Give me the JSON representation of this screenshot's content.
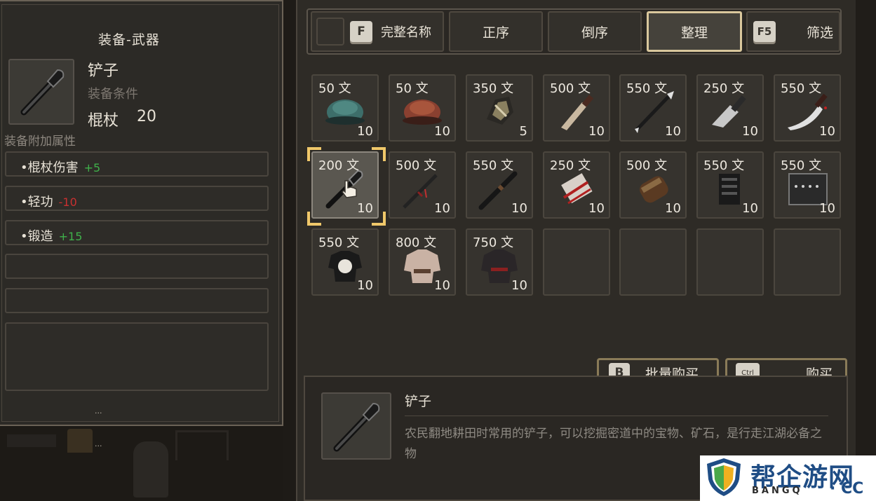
{
  "left": {
    "title": "装备-武器",
    "item_name": "铲子",
    "req_label": "装备条件",
    "req_stat": "棍杖",
    "req_value": "20",
    "extra_label": "装备附加属性",
    "attributes": [
      {
        "name": "•棍杖伤害",
        "value": "+5",
        "kind": "green"
      },
      {
        "name": "•轻功",
        "value": "-10",
        "kind": "red"
      },
      {
        "name": "•锻造",
        "value": "+15",
        "kind": "green"
      }
    ],
    "dots": "..."
  },
  "sortbar": {
    "key_f": "F",
    "full_name": "完整名称",
    "asc": "正序",
    "desc": "倒序",
    "arrange": "整理",
    "key_f5": "F5",
    "filter": "筛选"
  },
  "grid": {
    "currency": "文",
    "items": [
      {
        "price": "50",
        "qty": "10",
        "icon": "teal-cap-icon"
      },
      {
        "price": "50",
        "qty": "10",
        "icon": "brown-cap-icon"
      },
      {
        "price": "350",
        "qty": "5",
        "icon": "ore-icon"
      },
      {
        "price": "500",
        "qty": "10",
        "icon": "dagger-icon"
      },
      {
        "price": "550",
        "qty": "10",
        "icon": "spear-icon"
      },
      {
        "price": "250",
        "qty": "10",
        "icon": "cleaver-icon"
      },
      {
        "price": "550",
        "qty": "10",
        "icon": "broadsword-icon"
      },
      {
        "price": "200",
        "qty": "10",
        "icon": "shovel-icon"
      },
      {
        "price": "500",
        "qty": "10",
        "icon": "sword-icon"
      },
      {
        "price": "550",
        "qty": "10",
        "icon": "staff-icon"
      },
      {
        "price": "250",
        "qty": "10",
        "icon": "bandage-icon"
      },
      {
        "price": "500",
        "qty": "10",
        "icon": "bracer-icon"
      },
      {
        "price": "550",
        "qty": "10",
        "icon": "armor-vest-icon"
      },
      {
        "price": "550",
        "qty": "10",
        "icon": "plate-armor-icon"
      },
      {
        "price": "550",
        "qty": "10",
        "icon": "black-robe-icon"
      },
      {
        "price": "800",
        "qty": "10",
        "icon": "white-robe-icon"
      },
      {
        "price": "750",
        "qty": "10",
        "icon": "dark-robe-icon"
      }
    ]
  },
  "actions": {
    "key_b": "B",
    "bulk_buy": "批量购买",
    "key_ctrl": "Ctrl",
    "buy": "购买"
  },
  "description": {
    "name": "铲子",
    "text": "农民翻地耕田时常用的铲子，可以挖掘密道中的宝物、矿石，是行走江湖必备之物"
  },
  "watermark": {
    "title": "帮企游网",
    "sub": "BANGQ",
    "cc": "· CC"
  }
}
